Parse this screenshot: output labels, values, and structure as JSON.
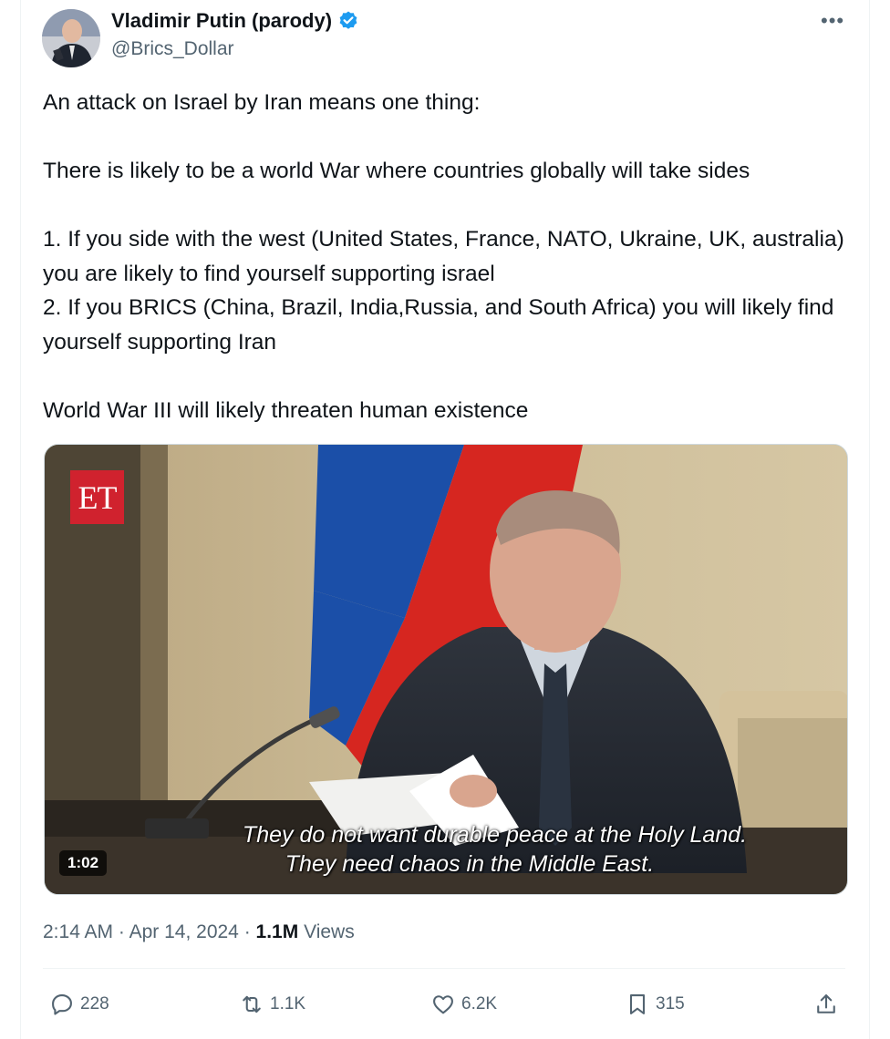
{
  "author": {
    "name": "Vladimir Putin (parody)",
    "handle": "@Brics_Dollar"
  },
  "tweet": {
    "paragraphs": [
      "An attack on Israel by Iran means one thing:",
      "",
      "There is likely to be a world War where countries globally will take sides",
      "",
      "1. If you side with the west (United States, France, NATO, Ukraine, UK, australia) you are likely to find yourself supporting israel",
      "2. If you BRICS (China, Brazil, India,Russia, and South Africa) you will likely find yourself supporting Iran",
      "",
      "World War III will likely threaten human existence"
    ]
  },
  "video": {
    "logo": "ET",
    "subtitle_line1": "They do not want durable peace at the Holy Land.",
    "subtitle_line2": "They need chaos in the Middle East.",
    "duration": "1:02"
  },
  "meta": {
    "time": "2:14 AM",
    "separator": "·",
    "date": "Apr 14, 2024",
    "views_count": "1.1M",
    "views_label": "Views"
  },
  "actions": {
    "replies": "228",
    "reposts": "1.1K",
    "likes": "6.2K",
    "bookmarks": "315"
  },
  "icons": {
    "more": "more-icon",
    "verified": "verified-badge-icon",
    "reply": "reply-icon",
    "repost": "repost-icon",
    "like": "heart-icon",
    "bookmark": "bookmark-icon",
    "share": "share-icon"
  },
  "colors": {
    "text": "#0f1419",
    "secondary": "#536471",
    "verified": "#1d9bf0",
    "et_red": "#d0222e"
  }
}
